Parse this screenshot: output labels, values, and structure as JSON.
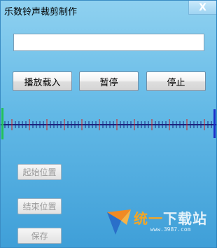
{
  "window": {
    "title": "乐数铃声裁剪制作",
    "close_label": "X"
  },
  "file_input": {
    "value": "",
    "placeholder": ""
  },
  "controls": {
    "play_load_label": "播放载入",
    "pause_label": "暂停",
    "stop_label": "停止"
  },
  "timeline": {
    "start_marker_color": "#22c05a",
    "end_marker_color": "#1a30c8",
    "line_color": "#1a237e",
    "tick_color": "#1a237e",
    "red_tick_color": "#d21f1f"
  },
  "actions": {
    "set_start_label": "起始位置",
    "set_end_label": "结束位置",
    "save_label": "保存"
  },
  "watermark": {
    "main_part1": "统一",
    "main_part2": "下载站",
    "sub": "www.3987.com"
  }
}
